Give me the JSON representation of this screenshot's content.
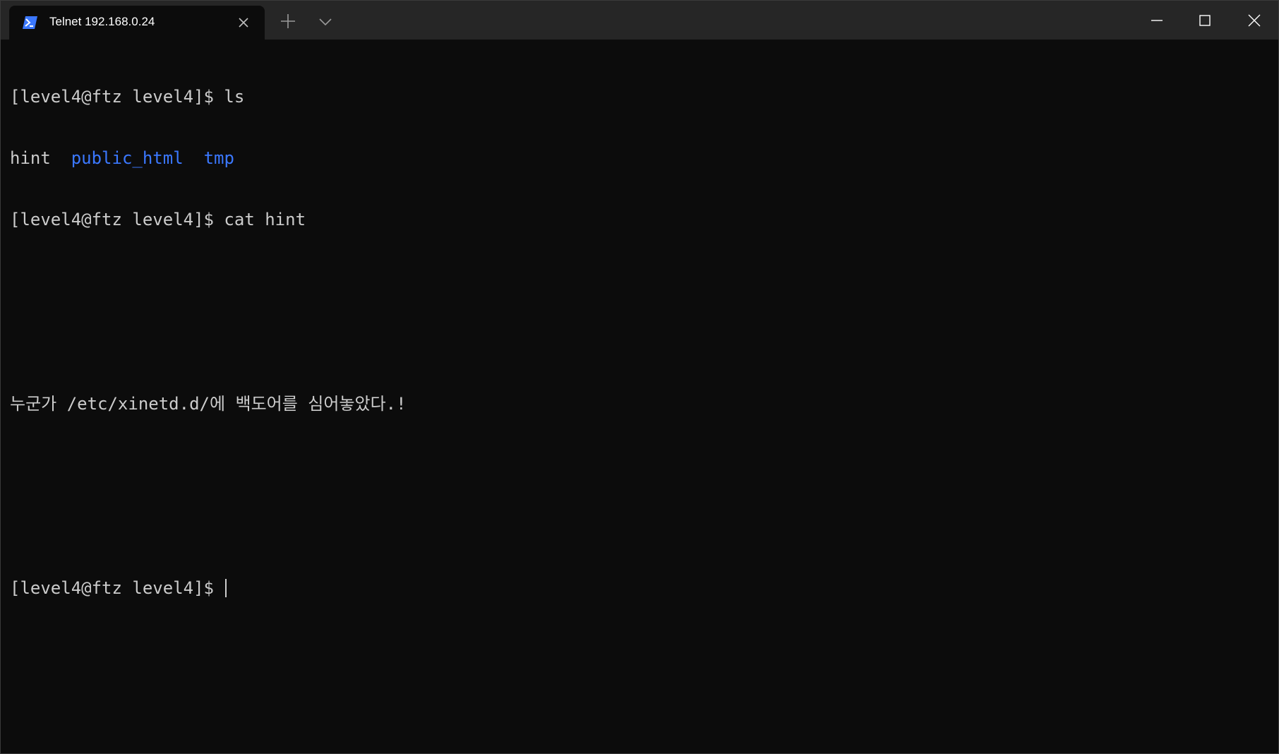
{
  "window": {
    "tab_title": "Telnet 192.168.0.24",
    "tab_icon": "powershell-icon",
    "accent_color": "#3b78ff",
    "background_color": "#0c0c0c",
    "text_color": "#cccccc"
  },
  "terminal": {
    "line1": "[level4@ftz level4]$ ls",
    "ls_output": {
      "file1": "hint",
      "sep1": "  ",
      "dir1": "public_html",
      "sep2": "  ",
      "dir2": "tmp"
    },
    "line3": "[level4@ftz level4]$ cat hint",
    "line4": "",
    "line5": "",
    "line6": "누군가 /etc/xinetd.d/에 백도어를 심어놓았다.!",
    "line7": "",
    "line8": "",
    "prompt": "[level4@ftz level4]$ "
  }
}
